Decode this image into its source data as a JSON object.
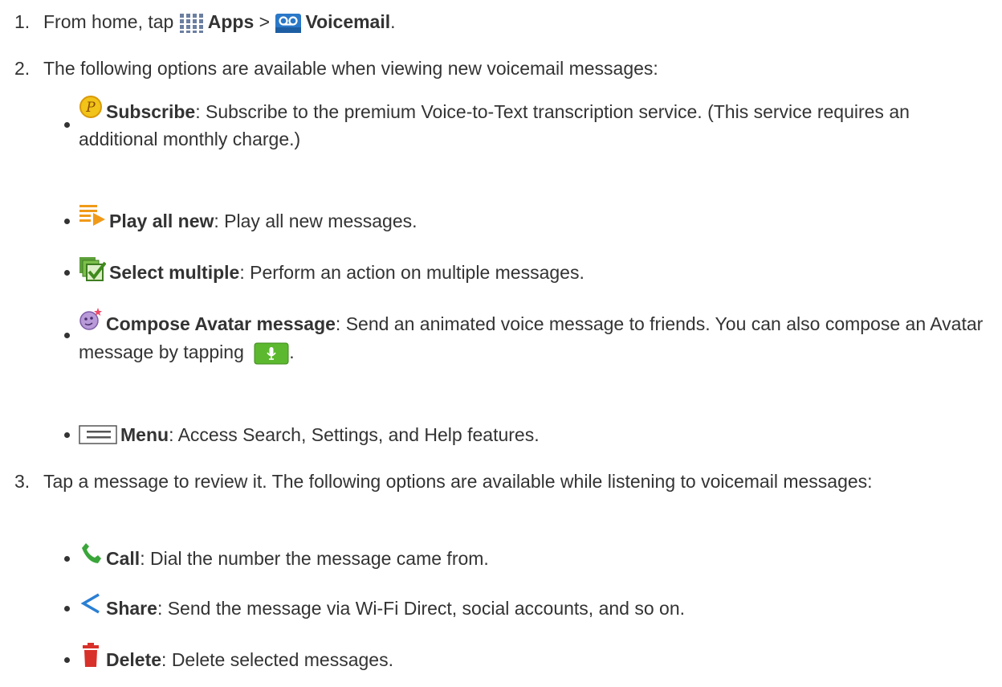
{
  "steps": [
    {
      "number": "1.",
      "prefix": "From home, tap",
      "apps_label": "Apps",
      "separator": ">",
      "voicemail_label": "Voicemail",
      "suffix": "."
    },
    {
      "number": "2.",
      "text": "The following options are available when viewing new voicemail messages:",
      "options": [
        {
          "icon": "subscribe-icon",
          "label": "Subscribe",
          "desc": ": Subscribe to the premium Voice-to-Text transcription service. (This service requires an additional monthly charge.)"
        },
        {
          "icon": "play-all-icon",
          "label": "Play all new",
          "desc": ": Play all new messages."
        },
        {
          "icon": "select-multiple-icon",
          "label": "Select multiple",
          "desc": ": Perform an action on multiple messages."
        },
        {
          "icon": "avatar-icon",
          "label": "Compose Avatar message",
          "desc": ": Send an animated voice message to friends. You can also compose an Avatar message by tapping",
          "desc_end": "."
        },
        {
          "icon": "menu-icon",
          "label": "Menu",
          "desc": ": Access Search, Settings, and Help features."
        }
      ]
    },
    {
      "number": "3.",
      "text": "Tap a message to review it. The following options are available while listening to voicemail messages:",
      "options": [
        {
          "icon": "call-icon",
          "label": "Call",
          "desc": ": Dial the number the message came from."
        },
        {
          "icon": "share-icon",
          "label": "Share",
          "desc": ": Send the message via Wi-Fi Direct, social accounts, and so on."
        },
        {
          "icon": "delete-icon",
          "label": "Delete",
          "desc": ": Delete selected messages."
        }
      ]
    }
  ],
  "colors": {
    "text": "#333333",
    "call_green": "#3aa63a",
    "share_blue": "#2a7fd4",
    "delete_red": "#d8302a",
    "mic_green": "#5cb82e"
  }
}
